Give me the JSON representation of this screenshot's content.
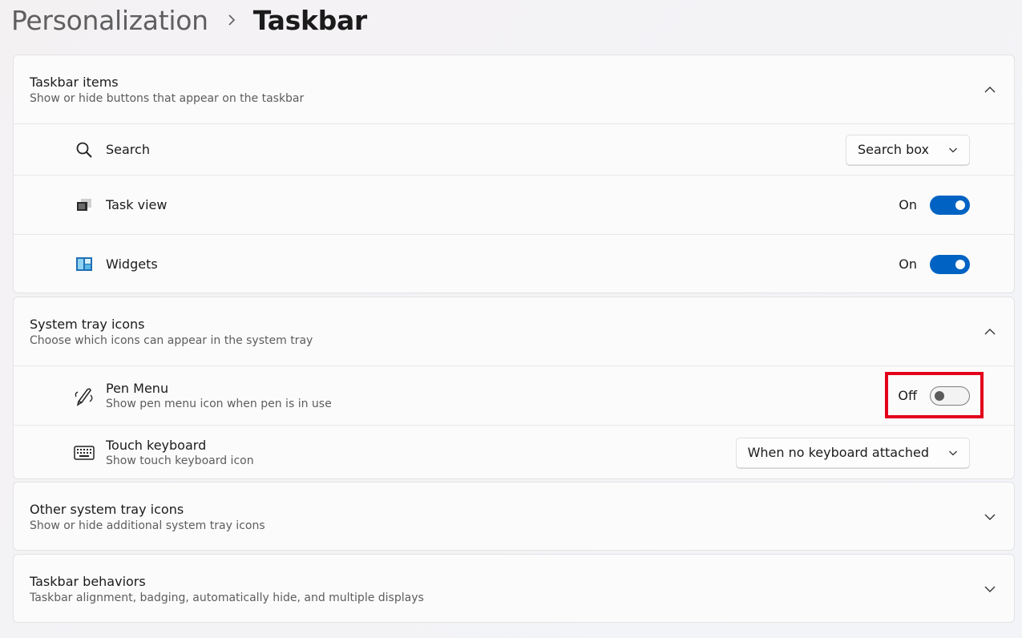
{
  "breadcrumb": {
    "parent": "Personalization",
    "current": "Taskbar"
  },
  "taskbar_items": {
    "title": "Taskbar items",
    "subtitle": "Show or hide buttons that appear on the taskbar",
    "expanded": true,
    "rows": {
      "search": {
        "label": "Search",
        "value": "Search box",
        "icon": "search-icon"
      },
      "task_view": {
        "label": "Task view",
        "state": "On",
        "icon": "task-view-icon"
      },
      "widgets": {
        "label": "Widgets",
        "state": "On",
        "icon": "widgets-icon"
      }
    }
  },
  "system_tray": {
    "title": "System tray icons",
    "subtitle": "Choose which icons can appear in the system tray",
    "expanded": true,
    "rows": {
      "pen_menu": {
        "label": "Pen Menu",
        "desc": "Show pen menu icon when pen is in use",
        "state": "Off",
        "icon": "pen-icon"
      },
      "touch_keyboard": {
        "label": "Touch keyboard",
        "desc": "Show touch keyboard icon",
        "value": "When no keyboard attached",
        "icon": "keyboard-icon"
      }
    }
  },
  "other_tray": {
    "title": "Other system tray icons",
    "subtitle": "Show or hide additional system tray icons",
    "expanded": false
  },
  "behaviors": {
    "title": "Taskbar behaviors",
    "subtitle": "Taskbar alignment, badging, automatically hide, and multiple displays",
    "expanded": false
  },
  "colors": {
    "accent": "#0063c3",
    "highlight": "#e3001b"
  }
}
